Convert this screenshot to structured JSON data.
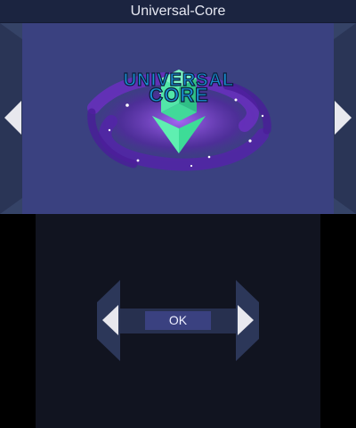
{
  "window": {
    "title": "Universal-Core"
  },
  "banner": {
    "logo_line1": "UNIVERSAL",
    "logo_line2": "CORE",
    "logo_icon": "green-gem-icon"
  },
  "top_nav": {
    "prev_icon": "triangle-left-icon",
    "next_icon": "triangle-right-icon"
  },
  "dialog": {
    "ok_label": "OK",
    "prev_icon": "triangle-left-icon",
    "next_icon": "triangle-right-icon"
  },
  "colors": {
    "banner_bg": "#3a4180",
    "gem": "#3ddc97",
    "logo_text": "#1a8fd1"
  }
}
